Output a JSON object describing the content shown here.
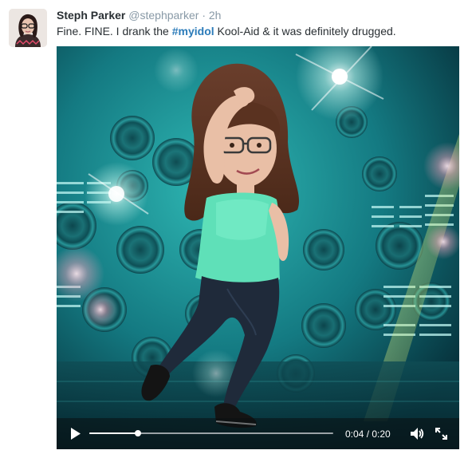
{
  "tweet": {
    "author_name": "Steph Parker",
    "author_handle": "@stephparker",
    "separator": "·",
    "timestamp": "2h",
    "text_before": "Fine. FINE. I drank the ",
    "hashtag": "#myidol",
    "text_after": " Kool-Aid & it was definitely drugged."
  },
  "video": {
    "current_time": "0:04",
    "duration": "0:20",
    "time_display": "0:04 / 0:20",
    "progress_fraction": 0.2,
    "icons": {
      "play": "play-icon",
      "volume": "volume-icon",
      "fullscreen": "fullscreen-icon"
    }
  },
  "colors": {
    "hashtag": "#2b7bb9",
    "secondary_text": "#8899a6",
    "primary_text": "#292f33",
    "video_bg": "#0a3a40",
    "shirt": "#5fe0b8",
    "pants": "#1f2a3a"
  }
}
